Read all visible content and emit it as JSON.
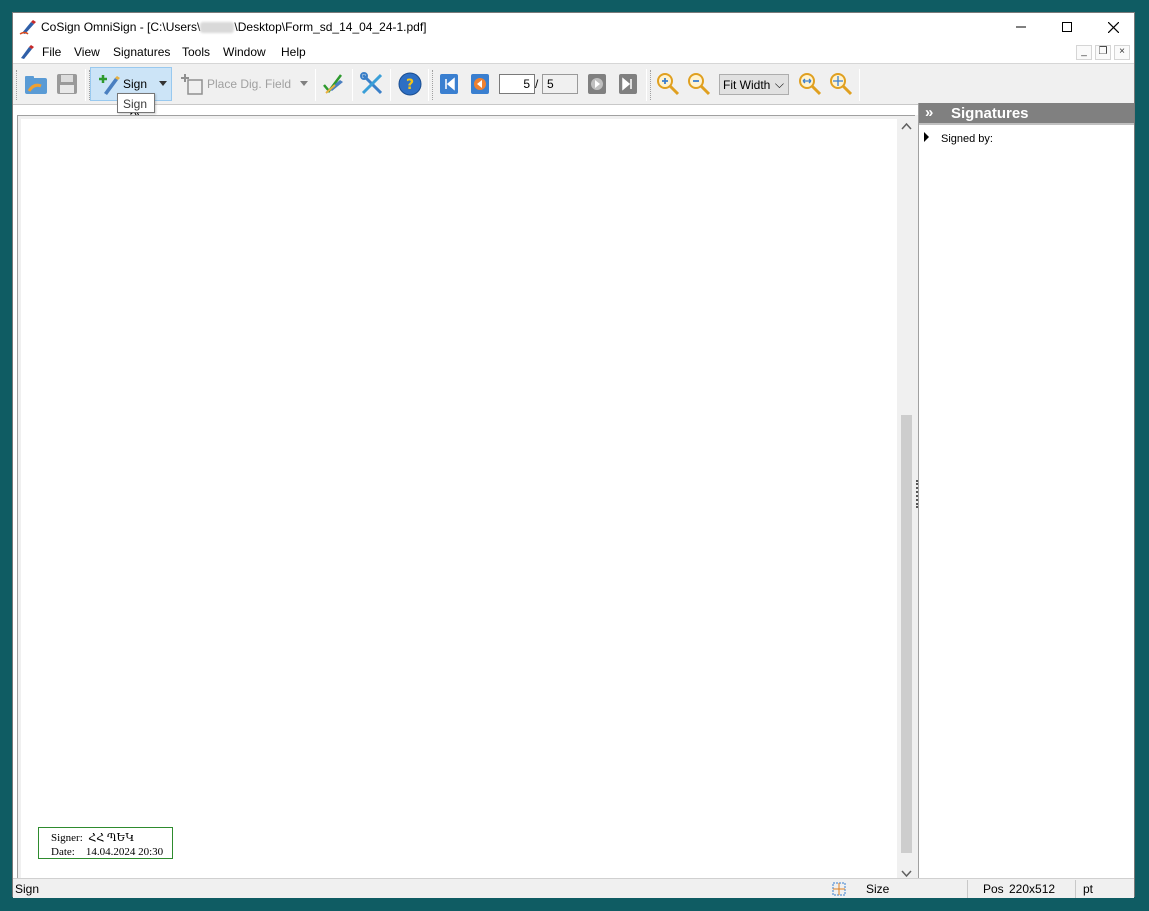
{
  "window": {
    "app_name": "CoSign OmniSign",
    "title_prefix": "CoSign OmniSign - [C:\\Users\\",
    "title_suffix": "\\Desktop\\Form_sd_14_04_24-1.pdf]",
    "controls": {
      "minimize": "—",
      "maximize": "☐",
      "close": "✕"
    }
  },
  "menu": {
    "items": [
      "File",
      "View",
      "Signatures",
      "Tools",
      "Window",
      "Help"
    ],
    "mdi": {
      "minimize": "_",
      "restore": "❐",
      "close": "×"
    }
  },
  "toolbar": {
    "sign_label": "Sign",
    "place_field_label": "Place Dig. Field",
    "current_page": "5",
    "page_separator": "/",
    "total_pages": "5",
    "zoom_value": "Fit Width",
    "zoom_arrow": "⌵"
  },
  "tooltip": {
    "text": "Sign"
  },
  "signature_stamp": {
    "signer_label": "Signer:",
    "signer_value": "ՀՀ ՊԵԿ",
    "date_label": "Date:",
    "date_value": "14.04.2024 20:30"
  },
  "signatures_panel": {
    "title": "Signatures",
    "header_chevron": "»",
    "signed_by_label": "Signed by:"
  },
  "statusbar": {
    "left_text": "Sign",
    "size_label": "Size",
    "pos_label": "Pos",
    "pos_value": "220x512",
    "unit": "pt"
  },
  "colors": {
    "desktop": "#0f5c63",
    "accent_hover": "#cce4f7",
    "panel_header": "#808080",
    "stamp_border": "#2e8b2e"
  },
  "icons": [
    "app-icon",
    "open-icon",
    "save-icon",
    "sign-icon",
    "place-field-icon",
    "verify-icon",
    "tools-icon",
    "help-icon",
    "first-page-icon",
    "prev-page-icon",
    "next-page-icon",
    "last-page-icon",
    "zoom-in-icon",
    "zoom-out-icon",
    "fit-width-icon",
    "zoom-area-icon",
    "mouse-cursor-icon",
    "position-grid-icon"
  ]
}
